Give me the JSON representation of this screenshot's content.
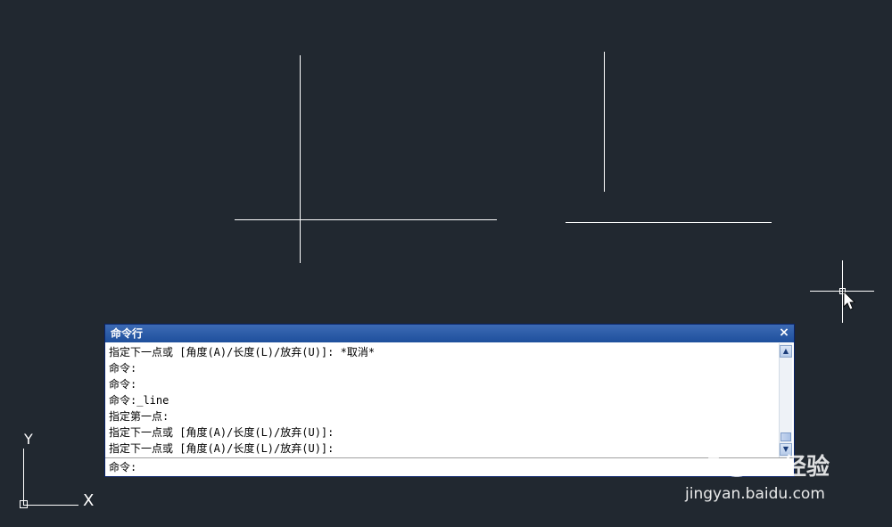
{
  "command_window": {
    "title": "命令行",
    "close_glyph": "×",
    "history": [
      "指定下一点或 [角度(A)/长度(L)/放弃(U)]: *取消*",
      "命令:",
      "命令:",
      "命令:_line",
      "指定第一点:",
      "指定下一点或 [角度(A)/长度(L)/放弃(U)]:",
      "指定下一点或 [角度(A)/长度(L)/放弃(U)]:"
    ],
    "prompt": "命令:",
    "input_value": ""
  },
  "ucs_icon": {
    "x_label": "X",
    "y_label": "Y"
  },
  "watermark": {
    "brand_text": "经验",
    "url_text": "jingyan.baidu.com"
  },
  "colors": {
    "model_space_background": "#212830",
    "drawing_lines": "#ffffff",
    "titlebar": "#1e4f9c"
  }
}
